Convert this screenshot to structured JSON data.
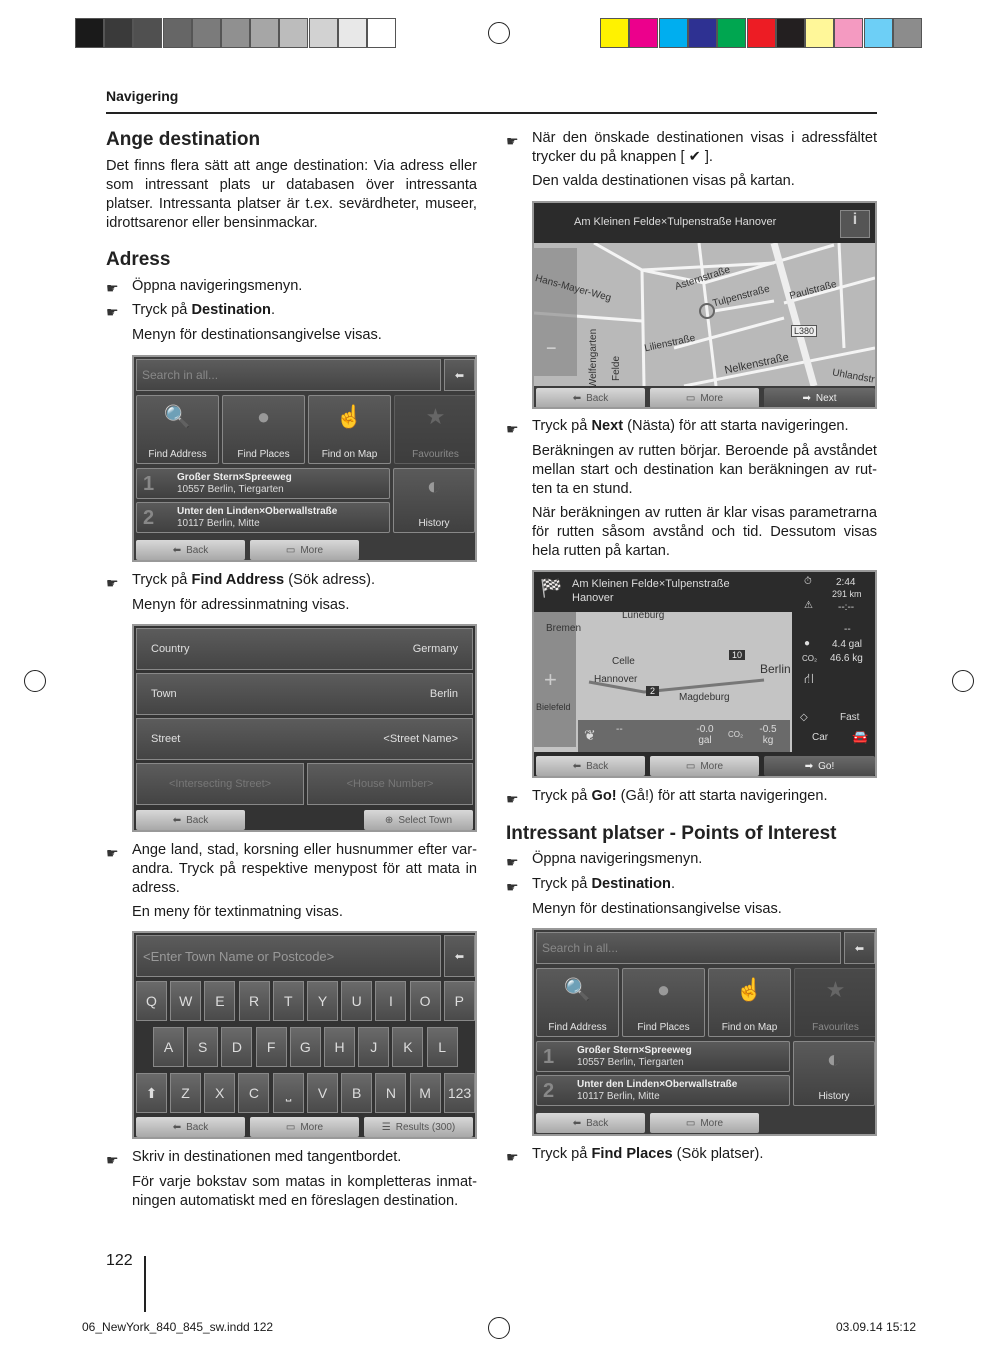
{
  "color_bars": {
    "gray": [
      "#1a1a1a",
      "#3a3a3a",
      "#505050",
      "#666666",
      "#7b7b7b",
      "#909090",
      "#a6a6a6",
      "#bcbcbc",
      "#d2d2d2",
      "#e8e8e8",
      "#ffffff"
    ],
    "color": [
      "#fff200",
      "#ec008c",
      "#00aeef",
      "#2e3192",
      "#00a650",
      "#ed1c24",
      "#231f20",
      "#fff799",
      "#f49ac1",
      "#6dcff6",
      "#8c8c8c"
    ]
  },
  "header": {
    "section": "Navigering"
  },
  "left": {
    "h_ange": "Ange destination",
    "p_intro": "Det finns flera sätt att ange destination: Via adress eller som intressant plats ur databasen över intressanta platser. Intressanta platser är t.ex. sevärdheter, museer, idrottsarenor eller bensinmackar.",
    "h_adress": "Adress",
    "step1": "Öppna navigeringsmenyn.",
    "step2_pre": "Tryck på ",
    "step2_bold": "Destination",
    "step2_post": ".",
    "menu_shown": "Menyn för destinationsangivelse visas.",
    "step3_pre": "Tryck på ",
    "step3_bold": "Find Address",
    "step3_post": " (Sök adress).",
    "addr_menu_shown": "Menyn för adressinmatning visas.",
    "step4": "Ange land, stad, korsning eller husnummer efter var­andra. Tryck på respektive menypost för att mata in adress.",
    "kbd_shown": "En meny för textinmatning visas.",
    "step5": "Skriv in destinationen med tangentbordet.",
    "step5_note": "För varje bokstav som matas in kompletteras inmat­ningen automatiskt med en föreslagen destination."
  },
  "right": {
    "step_check": "När den önskade destinationen visas i adressfältet trycker du på knappen [ ✔ ].",
    "dest_shown": "Den valda destinationen visas på kartan.",
    "next_pre": "Tryck på ",
    "next_bold": "Next",
    "next_post": " (Nästa) för att starta navigeringen.",
    "calc1": "Beräkningen av rutten börjar. Beroende på avståndet mellan start och destination kan beräkningen av rut­ten ta en stund.",
    "calc2": "När beräkningen av rutten är klar visas parametrarna för rutten såsom avstånd och tid. Dessutom visas hela rutten på kartan.",
    "go_pre": "Tryck på ",
    "go_bold": "Go!",
    "go_post": " (Gå!) för att starta navigeringen.",
    "h_poi": "Intressant platser - Points of Interest",
    "poi1": "Öppna navigeringsmenyn.",
    "poi2_pre": "Tryck på ",
    "poi2_bold": "Destination",
    "poi2_post": ".",
    "poi_menu": "Menyn för destinationsangivelse visas.",
    "poi3_pre": "Tryck på ",
    "poi3_bold": "Find Places",
    "poi3_post": " (Sök platser)."
  },
  "dest_screen": {
    "search_placeholder": "Search in all...",
    "tiles": [
      "Find Address",
      "Find Places",
      "Find on Map",
      "Favourites"
    ],
    "history": [
      {
        "num": "1",
        "line1": "Großer Stern×Spreeweg",
        "line2": "10557 Berlin, Tiergarten"
      },
      {
        "num": "2",
        "line1": "Unter den Linden×Oberwallstraße",
        "line2": "10117 Berlin, Mitte"
      }
    ],
    "history_label": "History",
    "back": "Back",
    "more": "More"
  },
  "addr_screen": {
    "rows": [
      {
        "label": "Country",
        "value": "Germany"
      },
      {
        "label": "Town",
        "value": "Berlin"
      },
      {
        "label": "Street",
        "value": "<Street Name>"
      }
    ],
    "intersecting": "<Intersecting Street>",
    "house": "<House Number>",
    "back": "Back",
    "select_town": "Select Town"
  },
  "kbd_screen": {
    "placeholder": "<Enter Town Name or Postcode>",
    "row1": [
      "Q",
      "W",
      "E",
      "R",
      "T",
      "Y",
      "U",
      "I",
      "O",
      "P"
    ],
    "row2": [
      "A",
      "S",
      "D",
      "F",
      "G",
      "H",
      "J",
      "K",
      "L"
    ],
    "row3a": [
      "Z",
      "X",
      "C"
    ],
    "row3b": [
      "V",
      "B",
      "N",
      "M"
    ],
    "num": "123",
    "back": "Back",
    "more": "More",
    "results": "Results (300)"
  },
  "map_screen": {
    "title": "Am Kleinen Felde×Tulpenstraße Hanover",
    "streets": [
      "Asternstraße",
      "Tulpenstraße",
      "Paulstraße",
      "Hans-Mayer-Weg",
      "Lilienstraße",
      "Nelkenstraße",
      "Welfengarten",
      "Felde",
      "Uhlandstr",
      "L380"
    ],
    "back": "Back",
    "more": "More",
    "next": "Next"
  },
  "route_screen": {
    "title1": "Am Kleinen Felde×Tulpenstraße",
    "title2": "Hanover",
    "time": "2:44",
    "dist": "291 km",
    "eta": "--:--",
    "toll": "--",
    "fuel": "4.4 gal",
    "co2": "46.6 kg",
    "mode": "Fast",
    "vehicle": "Car",
    "cities": [
      "Bremen",
      "Luneburg",
      "Celle",
      "Hannover",
      "Berlin",
      "Magdeburg",
      "Bielefeld"
    ],
    "road1": "10",
    "road2": "2",
    "eco_dash": "--",
    "eco_fuel": "-0.0 gal",
    "eco_co2": "-0.5 kg",
    "co2_label": "CO₂",
    "back": "Back",
    "more": "More",
    "go": "Go!"
  },
  "footer": {
    "page": "122",
    "file": "06_NewYork_840_845_sw.indd   122",
    "date": "03.09.14   15:12"
  }
}
